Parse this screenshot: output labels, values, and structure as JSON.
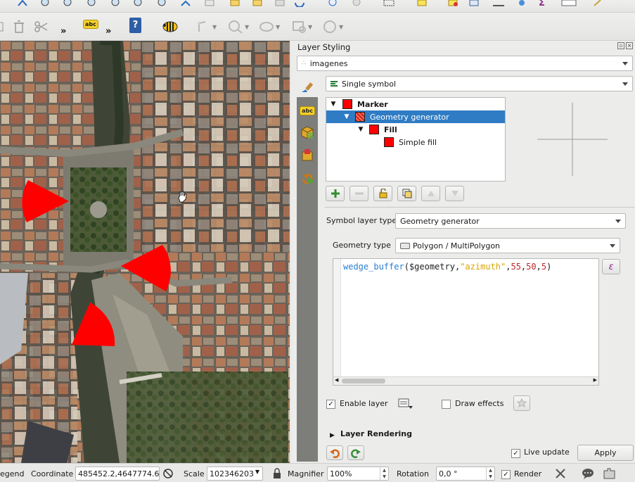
{
  "colors": {
    "accent": "#2f7cc4",
    "symbol_red": "#ff0000",
    "sidebar": "#7d7d7a",
    "string_orange": "#d9a700",
    "number_red": "#c0282a",
    "function_blue": "#2d7fd3"
  },
  "toolbar_top": {
    "icons": [
      "pan-icon",
      "zoom-in-icon",
      "zoom-out-icon",
      "zoom-full-icon",
      "zoom-layer-icon",
      "zoom-last-icon",
      "zoom-next-icon",
      "refresh-icon",
      "identify-icon",
      "select-icon",
      "measure-icon",
      "attribute-table-icon",
      "field-calc-icon",
      "stat-icon",
      "layout-icon",
      "text-annotation-icon",
      "python-icon"
    ]
  },
  "toolbar_second": {
    "chevron1": "»",
    "chevron2": "»",
    "label_icon_text": "abc",
    "help_icon_text": "?"
  },
  "panel": {
    "title": "Layer Styling",
    "layer_select": "imagenes",
    "renderer": "Single symbol",
    "symbol_tree": [
      {
        "label": "Marker",
        "bold": true,
        "level": 0,
        "swatch": true
      },
      {
        "label": "Geometry generator",
        "bold": false,
        "level": 1,
        "swatch": true,
        "selected": true
      },
      {
        "label": "Fill",
        "bold": true,
        "level": 2,
        "swatch": true
      },
      {
        "label": "Simple fill",
        "bold": false,
        "level": 3,
        "swatch": true
      }
    ],
    "symbol_layer_type_label": "Symbol layer type",
    "symbol_layer_type_value": "Geometry generator",
    "geometry_type_label": "Geometry type",
    "geometry_type_value": "Polygon / MultiPolygon",
    "expression": {
      "func": "wedge_buffer",
      "open": "(",
      "arg_geom": "$geometry",
      "comma1": ",",
      "arg_field": "\"azimuth\"",
      "comma2": ",",
      "n1": "55",
      "comma3": ",",
      "n2": "50",
      "comma4": ",",
      "n3": "5",
      "close": ")"
    },
    "expr_button": "ε",
    "enable_layer_label": "Enable layer",
    "enable_layer_checked": "✓",
    "draw_effects_label": "Draw effects",
    "layer_rendering_label": "Layer Rendering",
    "live_update_label": "Live update",
    "live_update_checked": "✓",
    "apply_label": "Apply"
  },
  "statusbar": {
    "legend_label": "egend",
    "coordinate_label": "Coordinate",
    "coordinate_value": "485452.2,4647774.6",
    "scale_label": "Scale",
    "scale_value": "102346203",
    "magnifier_label": "Magnifier",
    "magnifier_value": "100%",
    "rotation_label": "Rotation",
    "rotation_value": "0,0 °",
    "render_label": "Render",
    "render_checked": "✓"
  }
}
